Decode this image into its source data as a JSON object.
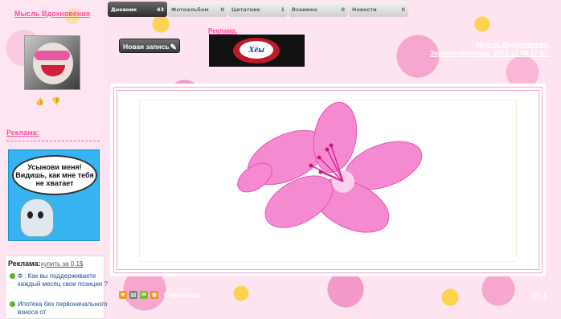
{
  "author": {
    "name": "Мысль Вдохновения"
  },
  "left_ad": {
    "label": "Реклама:",
    "banner_text": "Усынови меня! Видишь, как мне тебя не хватает"
  },
  "ad_box": {
    "title": "Реклама:",
    "buy_link": "купить за 0.1$",
    "items": [
      "Ф : Как вы поддерживаете каждый месяц свои позиции ?",
      "Ипотека без первоначального взноса от"
    ]
  },
  "nav": {
    "tabs": [
      {
        "label": "Дневник",
        "count": "43"
      },
      {
        "label": "Фотоальбом",
        "count": "0"
      },
      {
        "label": "Цитатник",
        "count": "1"
      },
      {
        "label": "Взаимно",
        "count": "0"
      },
      {
        "label": "Новости",
        "count": "0"
      }
    ]
  },
  "toolbar": {
    "new_post": "Новая запись"
  },
  "top_ad": {
    "label": "Реклама:",
    "logo_text": "Хёы"
  },
  "right_links": {
    "line1": "Мысль Вдохновения,",
    "line2": "Зарегистрирован: 2013-12-08 17:47:"
  },
  "footer": {
    "pages_label": "Страницы:",
    "page_numbers": "[2] 1"
  },
  "colors": {
    "accent": "#ff4fa0",
    "background": "#fde4f0",
    "flower": "#f06fc0"
  }
}
